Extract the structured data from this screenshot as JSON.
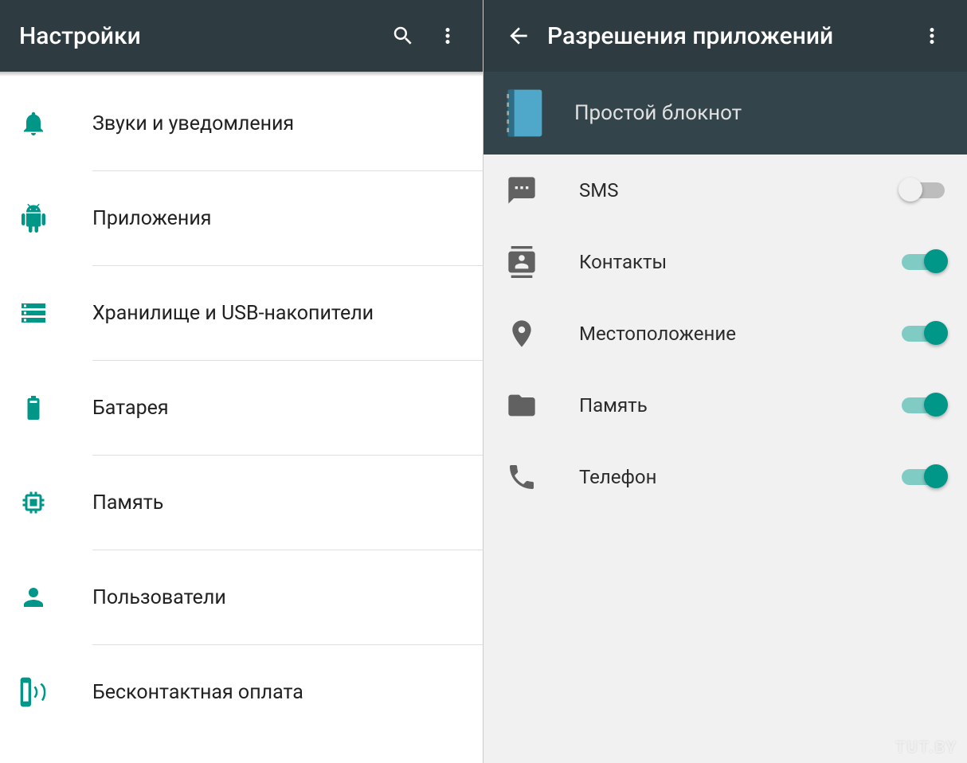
{
  "colors": {
    "accent": "#009688",
    "appbar": "#2e3b40",
    "strip": "#34444b"
  },
  "left": {
    "title": "Настройки",
    "items": [
      {
        "icon": "bell-icon",
        "label": "Звуки и уведомления"
      },
      {
        "icon": "android-icon",
        "label": "Приложения"
      },
      {
        "icon": "storage-icon",
        "label": "Хранилище и USB-накопители"
      },
      {
        "icon": "battery-icon",
        "label": "Батарея"
      },
      {
        "icon": "memory-icon",
        "label": "Память"
      },
      {
        "icon": "person-icon",
        "label": "Пользователи"
      },
      {
        "icon": "tap-pay-icon",
        "label": "Бесконтактная оплата"
      }
    ]
  },
  "right": {
    "title": "Разрешения приложений",
    "app_name": "Простой блокнот",
    "permissions": [
      {
        "icon": "sms-icon",
        "label": "SMS",
        "enabled": false
      },
      {
        "icon": "contacts-icon",
        "label": "Контакты",
        "enabled": true
      },
      {
        "icon": "location-icon",
        "label": "Местоположение",
        "enabled": true
      },
      {
        "icon": "folder-icon",
        "label": "Память",
        "enabled": true
      },
      {
        "icon": "phone-icon",
        "label": "Телефон",
        "enabled": true
      }
    ]
  },
  "watermark": "TUT.BY"
}
